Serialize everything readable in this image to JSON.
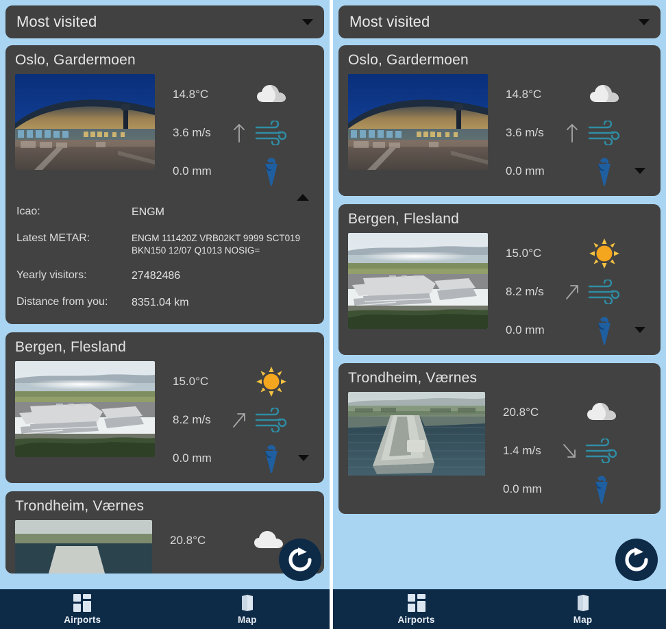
{
  "app": {
    "background_color": "#a9d5f3",
    "card_color": "#424242",
    "nav_color": "#0d2a47",
    "accent_wind_color": "#2e8ba3",
    "accent_rain_color": "#1f5fa0",
    "accent_sun_color": "#f5a623"
  },
  "filter": {
    "label": "Most visited",
    "chevron_icon": "chevron-down-icon"
  },
  "airports": [
    {
      "name": "Oslo, Gardermoen",
      "photo_icon": "oslo-terminal-photo",
      "temperature": "14.8°C",
      "weather_icon": "cloud-icon",
      "wind_speed": "3.6 m/s",
      "wind_direction_icon": "arrow-up-icon",
      "wind_icon": "wind-icon",
      "precipitation": "0.0 mm",
      "precipitation_icon": "umbrella-icon",
      "expanded": true,
      "toggle_icon": "chevron-up-icon",
      "details": [
        {
          "key": "Icao:",
          "value": "ENGM"
        },
        {
          "key": "Latest METAR:",
          "value": "ENGM 111420Z VRB02KT 9999 SCT019 BKN150 12/07 Q1013 NOSIG="
        },
        {
          "key": "Yearly visitors:",
          "value": "27482486"
        },
        {
          "key": "Distance from you:",
          "value": "8351.04 km"
        }
      ]
    },
    {
      "name": "Bergen, Flesland",
      "photo_icon": "bergen-airport-photo",
      "temperature": "15.0°C",
      "weather_icon": "sun-icon",
      "wind_speed": "8.2 m/s",
      "wind_direction_icon": "arrow-up-right-icon",
      "wind_icon": "wind-icon",
      "precipitation": "0.0 mm",
      "precipitation_icon": "umbrella-icon",
      "expanded": false,
      "toggle_icon": "chevron-down-icon"
    },
    {
      "name": "Trondheim, Værnes",
      "photo_icon": "trondheim-airport-photo",
      "temperature": "20.8°C",
      "weather_icon": "cloud-icon",
      "wind_speed": "1.4 m/s",
      "wind_direction_icon": "arrow-down-right-icon",
      "wind_icon": "wind-icon",
      "precipitation": "0.0 mm",
      "precipitation_icon": "umbrella-icon",
      "expanded": false,
      "toggle_icon": "chevron-down-icon"
    }
  ],
  "fab": {
    "icon": "refresh-icon",
    "label": "Refresh"
  },
  "bottom_nav": {
    "items": [
      {
        "label": "Airports",
        "icon": "dashboard-grid-icon",
        "active": true
      },
      {
        "label": "Map",
        "icon": "map-icon",
        "active": false
      }
    ]
  },
  "panels": {
    "left": {
      "details_visible": true
    },
    "right": {
      "details_visible": false
    }
  }
}
